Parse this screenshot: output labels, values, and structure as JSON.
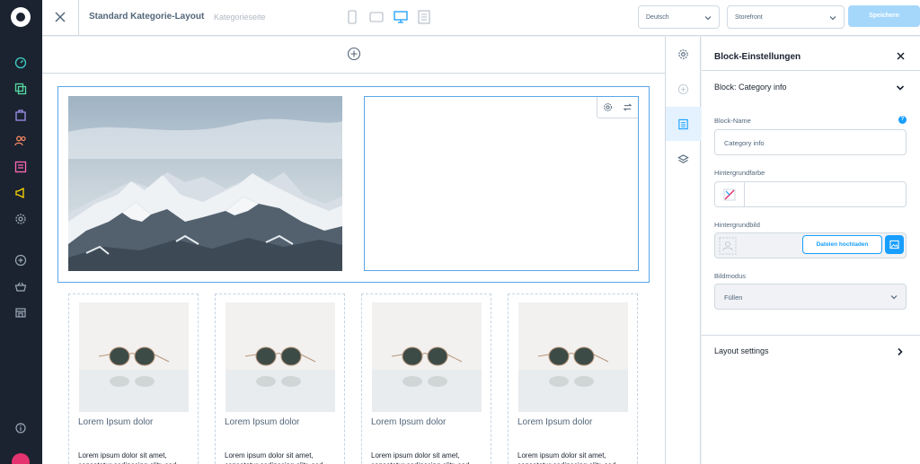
{
  "header": {
    "title": "Standard Kategorie-Layout",
    "subtitle": "Kategorieseite",
    "language": "Deutsch",
    "sales_channel": "Storefront",
    "save_label": "Speichern"
  },
  "products": [
    {
      "name": "Lorem Ipsum dolor",
      "description": "Lorem ipsum dolor sit amet, consetetur sadipscing elitr, sed"
    },
    {
      "name": "Lorem Ipsum dolor",
      "description": "Lorem ipsum dolor sit amet, consetetur sadipscing elitr, sed"
    },
    {
      "name": "Lorem Ipsum dolor",
      "description": "Lorem ipsum dolor sit amet, consetetur sadipscing elitr, sed"
    },
    {
      "name": "Lorem Ipsum dolor",
      "description": "Lorem ipsum dolor sit amet, consetetur sadipscing elitr, sed"
    }
  ],
  "panel": {
    "title": "Block-Einstellungen",
    "block_label": "Block: Category info",
    "block_name_label": "Block-Name",
    "block_name_value": "Category info",
    "bg_color_label": "Hintergrundfarbe",
    "bg_image_label": "Hintergrundbild",
    "upload_label": "Dateien hochladen",
    "display_mode_label": "Bildmodus",
    "display_mode_value": "Füllen",
    "layout_settings_label": "Layout settings"
  },
  "colors": {
    "accent": "#189eff",
    "nav_bg": "#1b2330",
    "selection": "#5aa6e8"
  }
}
